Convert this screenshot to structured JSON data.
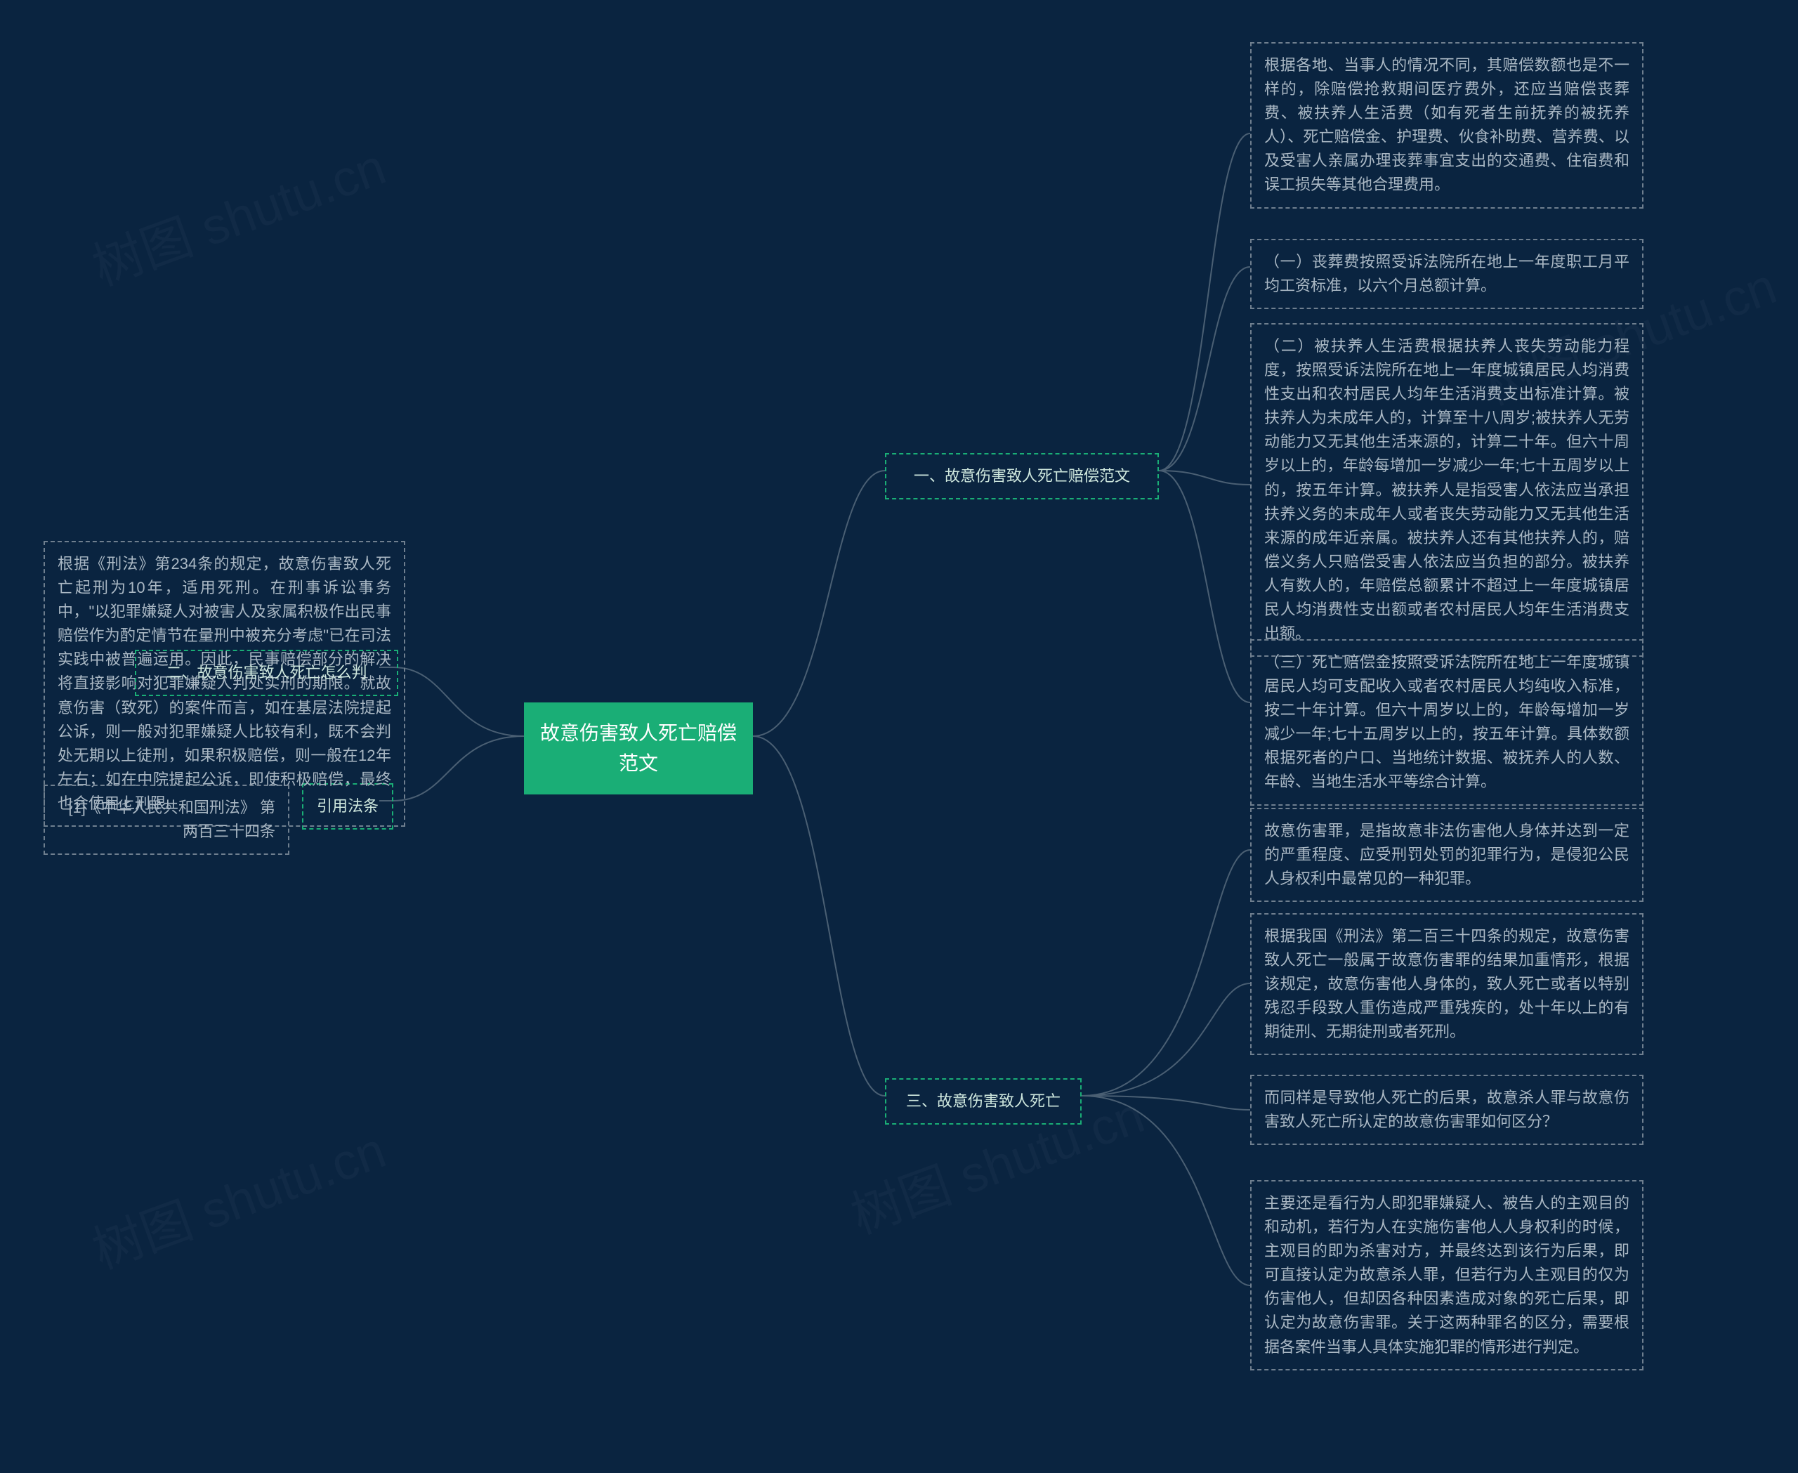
{
  "watermark": "树图 shutu.cn",
  "root": "故意伤害致人死亡赔偿范文",
  "right": {
    "b1": {
      "label": "一、故意伤害致人死亡赔偿范文",
      "leaves": [
        "根据各地、当事人的情况不同，其赔偿数额也是不一样的，除赔偿抢救期间医疗费外，还应当赔偿丧葬费、被扶养人生活费（如有死者生前抚养的被抚养人）、死亡赔偿金、护理费、伙食补助费、营养费、以及受害人亲属办理丧葬事宜支出的交通费、住宿费和误工损失等其他合理费用。",
        "（一）丧葬费按照受诉法院所在地上一年度职工月平均工资标准，以六个月总额计算。",
        "（二）被扶养人生活费根据扶养人丧失劳动能力程度，按照受诉法院所在地上一年度城镇居民人均消费性支出和农村居民人均年生活消费支出标准计算。被扶养人为未成年人的，计算至十八周岁;被扶养人无劳动能力又无其他生活来源的，计算二十年。但六十周岁以上的，年龄每增加一岁减少一年;七十五周岁以上的，按五年计算。被扶养人是指受害人依法应当承担扶养义务的未成年人或者丧失劳动能力又无其他生活来源的成年近亲属。被扶养人还有其他扶养人的，赔偿义务人只赔偿受害人依法应当负担的部分。被扶养人有数人的，年赔偿总额累计不超过上一年度城镇居民人均消费性支出额或者农村居民人均年生活消费支出额。",
        "（三）死亡赔偿金按照受诉法院所在地上一年度城镇居民人均可支配收入或者农村居民人均纯收入标准，按二十年计算。但六十周岁以上的，年龄每增加一岁减少一年;七十五周岁以上的，按五年计算。具体数额根据死者的户口、当地统计数据、被抚养人的人数、年龄、当地生活水平等综合计算。"
      ]
    },
    "b2": {
      "label": "三、故意伤害致人死亡",
      "leaves": [
        "故意伤害罪，是指故意非法伤害他人身体并达到一定的严重程度、应受刑罚处罚的犯罪行为，是侵犯公民人身权利中最常见的一种犯罪。",
        "根据我国《刑法》第二百三十四条的规定，故意伤害致人死亡一般属于故意伤害罪的结果加重情形，根据该规定，故意伤害他人身体的，致人死亡或者以特别残忍手段致人重伤造成严重残疾的，处十年以上的有期徒刑、无期徒刑或者死刑。",
        "而同样是导致他人死亡的后果，故意杀人罪与故意伤害致人死亡所认定的故意伤害罪如何区分？",
        "主要还是看行为人即犯罪嫌疑人、被告人的主观目的和动机，若行为人在实施伤害他人人身权利的时候，主观目的即为杀害对方，并最终达到该行为后果，即可直接认定为故意杀人罪，但若行为人主观目的仅为伤害他人，但却因各种因素造成对象的死亡后果，即认定为故意伤害罪。关于这两种罪名的区分，需要根据各案件当事人具体实施犯罪的情形进行判定。"
      ]
    }
  },
  "left": {
    "b1": {
      "label": "二、故意伤害致人死亡怎么判",
      "leaf": "根据《刑法》第234条的规定，故意伤害致人死亡起刑为10年，适用死刑。在刑事诉讼事务中，\"以犯罪嫌疑人对被害人及家属积极作出民事赔偿作为酌定情节在量刑中被充分考虑\"已在司法实践中被普遍运用。因此，民事赔偿部分的解决将直接影响对犯罪嫌疑人判处实刑的期限。就故意伤害（致死）的案件而言，如在基层法院提起公诉，则一般对犯罪嫌疑人比较有利，既不会判处无期以上徒刑，如果积极赔偿，则一般在12年左右；如在中院提起公诉，即使积极赔偿，最终也会使用上刑限。"
    },
    "b2": {
      "label": "引用法条",
      "leaf": "[1]《中华人民共和国刑法》 第两百三十四条"
    }
  },
  "chart_data": {
    "type": "mindmap",
    "root": "故意伤害致人死亡赔偿范文",
    "children": [
      {
        "side": "right",
        "label": "一、故意伤害致人死亡赔偿范文",
        "children": [
          "根据各地、当事人的情况不同，其赔偿数额也是不一样的…其他合理费用。",
          "（一）丧葬费按照受诉法院所在地上一年度职工月平均工资标准，以六个月总额计算。",
          "（二）被扶养人生活费根据扶养人丧失劳动能力程度…支出额。",
          "（三）死亡赔偿金按照受诉法院所在地上一年度…综合计算。"
        ]
      },
      {
        "side": "right",
        "label": "三、故意伤害致人死亡",
        "children": [
          "故意伤害罪，是指故意非法伤害他人身体并达到一定的严重程度…一种犯罪。",
          "根据我国《刑法》第二百三十四条的规定…或者死刑。",
          "而同样是导致他人死亡的后果…如何区分？",
          "主要还是看行为人即犯罪嫌疑人、被告人的主观目的和动机…进行判定。"
        ]
      },
      {
        "side": "left",
        "label": "二、故意伤害致人死亡怎么判",
        "children": [
          "根据《刑法》第234条的规定，故意伤害致人死亡起刑为10年…使用上刑限。"
        ]
      },
      {
        "side": "left",
        "label": "引用法条",
        "children": [
          "[1]《中华人民共和国刑法》 第两百三十四条"
        ]
      }
    ]
  }
}
